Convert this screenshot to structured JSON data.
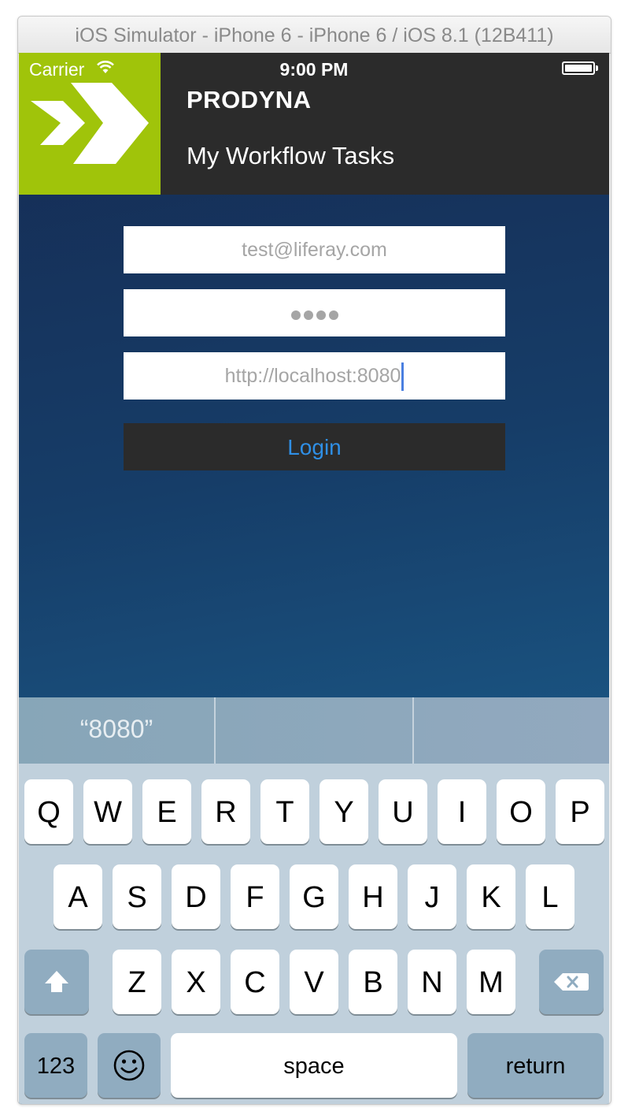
{
  "window": {
    "title": "iOS Simulator - iPhone 6 - iPhone 6 / iOS 8.1 (12B411)"
  },
  "status_bar": {
    "carrier": "Carrier",
    "time": "9:00 PM"
  },
  "header": {
    "title": "PRODYNA",
    "subtitle": "My Workflow Tasks",
    "logo_color": "#a0c40a"
  },
  "form": {
    "email_placeholder": "test@liferay.com",
    "server_url_value": "http://localhost:8080",
    "password_mask_length": 4,
    "login_label": "Login",
    "login_color": "#2f8fe6"
  },
  "suggestions": [
    "“8080”",
    "",
    ""
  ],
  "keyboard": {
    "row1": [
      "Q",
      "W",
      "E",
      "R",
      "T",
      "Y",
      "U",
      "I",
      "O",
      "P"
    ],
    "row2": [
      "A",
      "S",
      "D",
      "F",
      "G",
      "H",
      "J",
      "K",
      "L"
    ],
    "row3": [
      "Z",
      "X",
      "C",
      "V",
      "B",
      "N",
      "M"
    ],
    "numbers_label": "123",
    "space_label": "space",
    "return_label": "return",
    "shift_icon": "shift-icon",
    "delete_icon": "delete-icon",
    "emoji_icon": "emoji-icon"
  }
}
